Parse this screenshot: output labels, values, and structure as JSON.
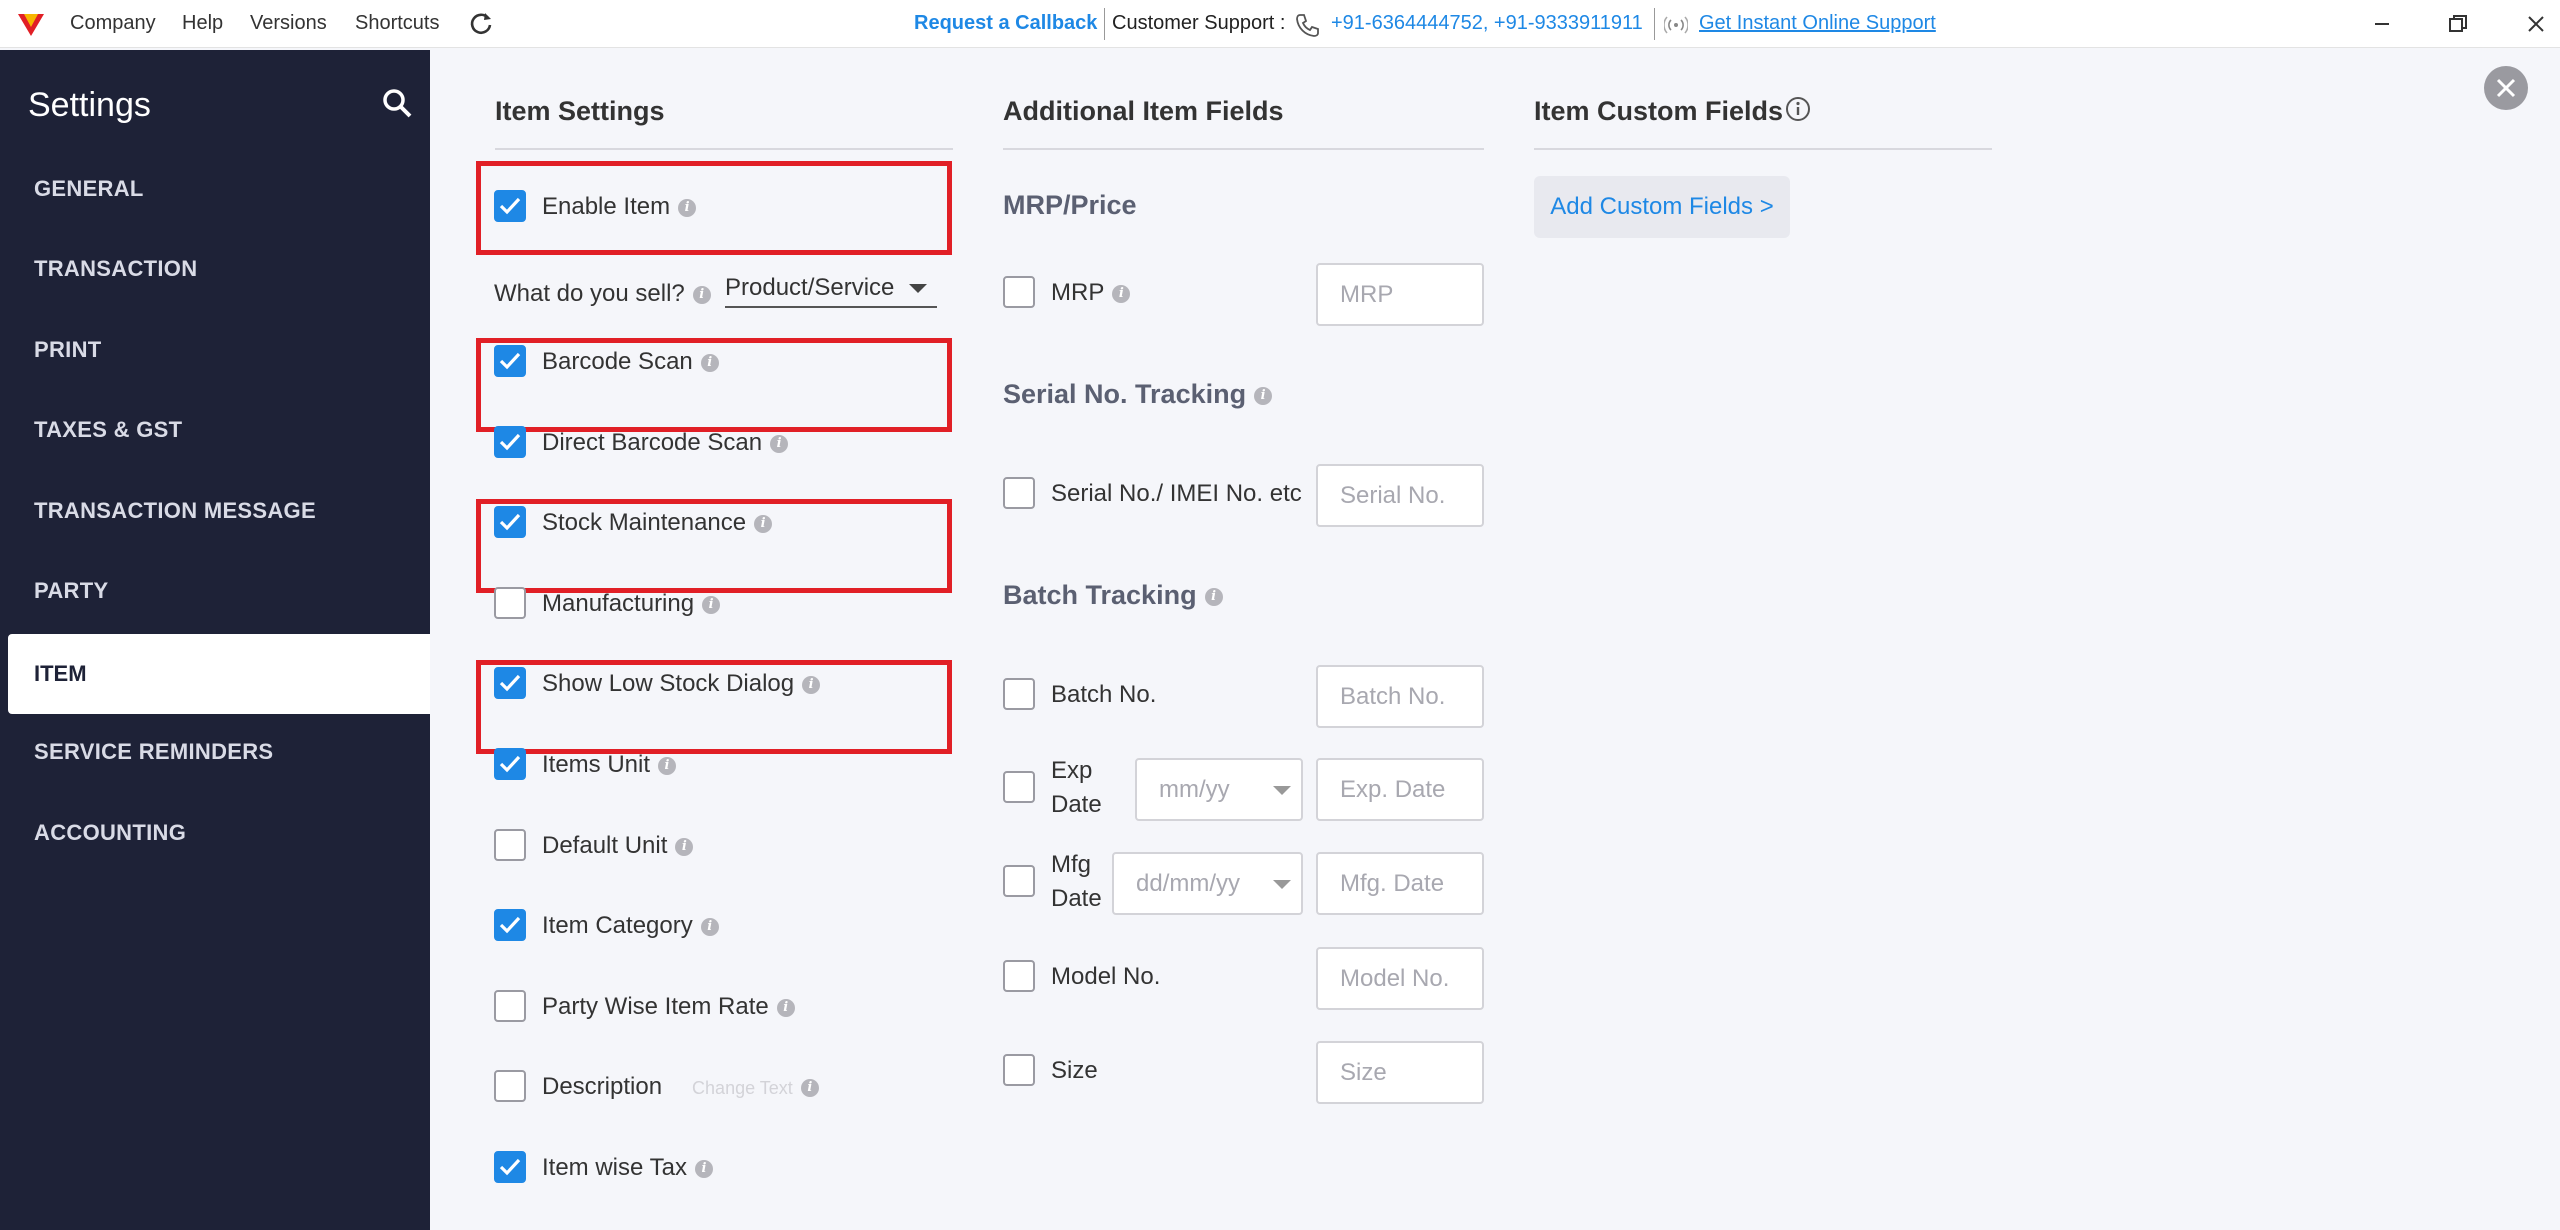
{
  "app": {
    "menu": [
      "Company",
      "Help",
      "Versions",
      "Shortcuts"
    ],
    "request_callback": "Request a Callback",
    "support_label": "Customer Support :",
    "support_phones": "+91-6364444752, +91-9333911911",
    "online_support": "Get Instant Online Support"
  },
  "sidebar": {
    "title": "Settings",
    "items": [
      "GENERAL",
      "TRANSACTION",
      "PRINT",
      "TAXES & GST",
      "TRANSACTION MESSAGE",
      "PARTY",
      "ITEM",
      "SERVICE REMINDERS",
      "ACCOUNTING"
    ],
    "active": "ITEM"
  },
  "item_settings": {
    "heading": "Item Settings",
    "enable_item": {
      "label": "Enable Item",
      "checked": true
    },
    "what_sell_label": "What do you sell?",
    "what_sell_value": "Product/Service",
    "rows": [
      {
        "label": "Barcode Scan",
        "checked": true
      },
      {
        "label": "Direct Barcode Scan",
        "checked": true
      },
      {
        "label": "Stock Maintenance",
        "checked": true
      },
      {
        "label": "Manufacturing",
        "checked": false
      },
      {
        "label": "Show Low Stock Dialog",
        "checked": true
      },
      {
        "label": "Items Unit",
        "checked": true
      },
      {
        "label": "Default Unit",
        "checked": false
      },
      {
        "label": "Item Category",
        "checked": true
      },
      {
        "label": "Party Wise Item Rate",
        "checked": false
      },
      {
        "label": "Description",
        "checked": false
      },
      {
        "label": "Item wise Tax",
        "checked": true
      }
    ],
    "change_text": "Change Text"
  },
  "additional_fields": {
    "heading": "Additional Item Fields",
    "mrp_heading": "MRP/Price",
    "mrp_label": "MRP",
    "mrp_placeholder": "MRP",
    "serial_heading": "Serial No. Tracking",
    "serial_label": "Serial No./ IMEI No. etc",
    "serial_placeholder": "Serial No.",
    "batch_heading": "Batch Tracking",
    "batch_label": "Batch No.",
    "batch_placeholder": "Batch No.",
    "exp_label_1": "Exp",
    "exp_label_2": "Date",
    "exp_format": "mm/yy",
    "exp_placeholder": "Exp. Date",
    "mfg_label_1": "Mfg",
    "mfg_label_2": "Date",
    "mfg_format": "dd/mm/yy",
    "mfg_placeholder": "Mfg. Date",
    "model_label": "Model No.",
    "model_placeholder": "Model No.",
    "size_label": "Size",
    "size_placeholder": "Size"
  },
  "custom_fields": {
    "heading": "Item Custom Fields",
    "add_button": "Add Custom Fields >"
  },
  "colors": {
    "sidebar_bg": "#1e2237",
    "accent": "#1e88e5",
    "highlight": "#e11f26"
  }
}
